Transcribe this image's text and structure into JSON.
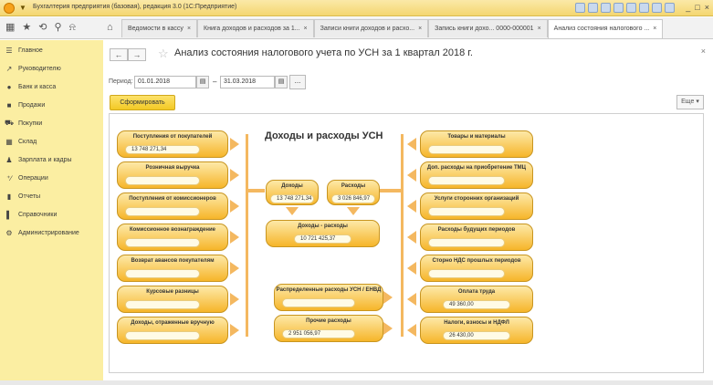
{
  "window": {
    "title": "Бухгалтерия предприятия (базовая), редакция 3.0  (1С:Предприятие)",
    "controls": [
      "_",
      "□",
      "×"
    ]
  },
  "tabs": [
    {
      "label": "Ведомости в кассу",
      "active": false
    },
    {
      "label": "Книга доходов и расходов за 1...",
      "active": false
    },
    {
      "label": "Записи книги доходов и расхо...",
      "active": false
    },
    {
      "label": "Запись книги дохо... 0000-000001",
      "active": false
    },
    {
      "label": "Анализ состояния налогового ...",
      "active": true
    }
  ],
  "sidebar": {
    "items": [
      {
        "label": "Главное",
        "icon": "menu-icon"
      },
      {
        "label": "Руководителю",
        "icon": "chart-line-icon"
      },
      {
        "label": "Банк и касса",
        "icon": "coin-icon"
      },
      {
        "label": "Продажи",
        "icon": "bag-icon"
      },
      {
        "label": "Покупки",
        "icon": "cart-icon"
      },
      {
        "label": "Склад",
        "icon": "warehouse-icon"
      },
      {
        "label": "Зарплата и кадры",
        "icon": "person-icon"
      },
      {
        "label": "Операции",
        "icon": "operations-icon"
      },
      {
        "label": "Отчеты",
        "icon": "bar-chart-icon"
      },
      {
        "label": "Справочники",
        "icon": "book-icon"
      },
      {
        "label": "Администрирование",
        "icon": "gear-icon"
      }
    ]
  },
  "document": {
    "title": "Анализ состояния налогового учета по УСН за 1 квартал 2018 г.",
    "period_label": "Период:",
    "date_from": "01.01.2018",
    "date_to": "31.03.2018",
    "dash": "–",
    "dots": "...",
    "form_button": "Сформировать",
    "more_button": "Еще ▾"
  },
  "report": {
    "title": "Доходы и расходы УСН",
    "income_boxes": [
      {
        "label": "Поступления от покупателей",
        "value": "13 748 271,34"
      },
      {
        "label": "Розничная выручка",
        "value": ""
      },
      {
        "label": "Поступления от комиссионеров",
        "value": ""
      },
      {
        "label": "Комиссионное вознаграждение",
        "value": ""
      },
      {
        "label": "Возврат авансов покупателям",
        "value": ""
      },
      {
        "label": "Курсовые разницы",
        "value": ""
      },
      {
        "label": "Доходы, отраженные вручную",
        "value": ""
      }
    ],
    "expense_boxes": [
      {
        "label": "Товары и материалы",
        "value": ""
      },
      {
        "label": "Доп. расходы на приобретение ТМЦ",
        "value": ""
      },
      {
        "label": "Услуги сторонних организаций",
        "value": ""
      },
      {
        "label": "Расходы будущих периодов",
        "value": ""
      },
      {
        "label": "Сторно НДС прошлых периодов",
        "value": ""
      },
      {
        "label": "Оплата труда",
        "value": "49 360,00"
      },
      {
        "label": "Налоги, взносы и НДФЛ",
        "value": "26 430,00"
      }
    ],
    "center": {
      "income": {
        "label": "Доходы",
        "value": "13 748 271,34"
      },
      "expenses": {
        "label": "Расходы",
        "value": "3 026 846,97"
      },
      "result": {
        "label": "Доходы - расходы",
        "value": "10 721 425,37"
      },
      "distributed": {
        "label": "Распределенные расходы УСН / ЕНВД",
        "value": ""
      },
      "other": {
        "label": "Прочие расходы",
        "value": "2 951 056,97"
      }
    }
  },
  "colors": {
    "sidebar": "#fbeea2",
    "accent": "#f6b52a",
    "connector": "#f4b860"
  }
}
